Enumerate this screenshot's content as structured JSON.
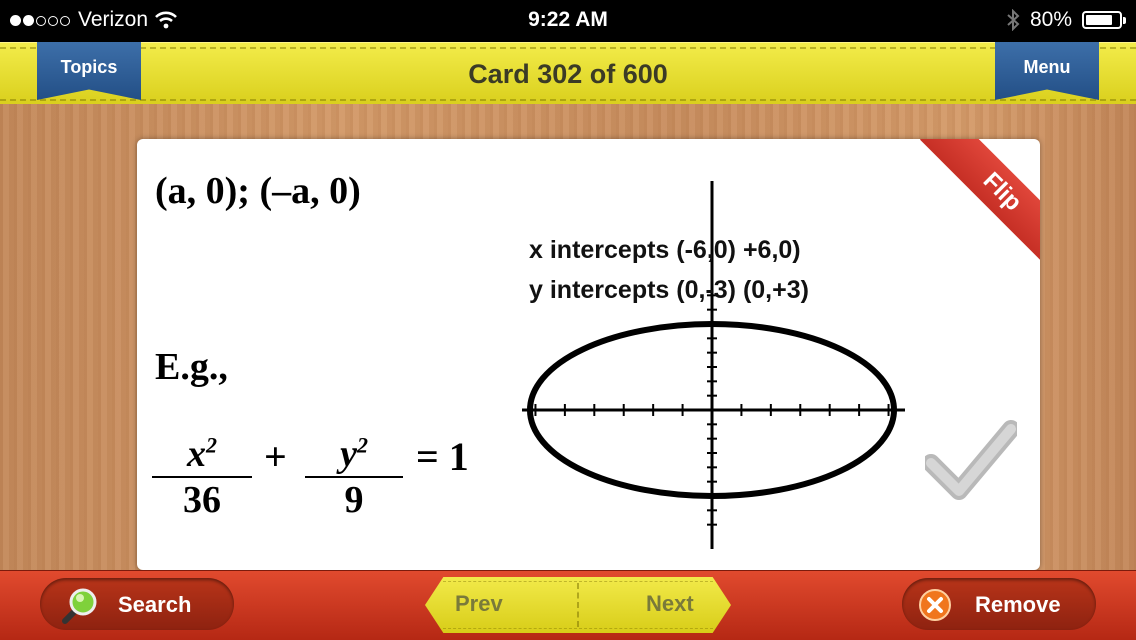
{
  "status_bar": {
    "signal_dots_filled": 2,
    "signal_dots_total": 5,
    "carrier": "Verizon",
    "time": "9:22 AM",
    "battery_percent": "80%",
    "battery_level": 0.8
  },
  "header": {
    "topics_label": "Topics",
    "title": "Card 302 of 600",
    "menu_label": "Menu"
  },
  "card": {
    "flip_label": "Flip",
    "intercepts_text": "(a,  0);  (–a,  0)",
    "example_label": "E.g.,",
    "equation": {
      "term1_num": "x",
      "term1_exp": "2",
      "term1_den": "36",
      "plus": "+",
      "term2_num": "y",
      "term2_exp": "2",
      "term2_den": "9",
      "equals": "= 1"
    },
    "graph": {
      "x_intercepts_label": "x intercepts (-6,0) +6,0)",
      "y_intercepts_label": "y intercepts (0,-3) (0,+3)",
      "semi_major": 6,
      "semi_minor": 3
    }
  },
  "footer": {
    "search_label": "Search",
    "prev_label": "Prev",
    "next_label": "Next",
    "remove_label": "Remove"
  },
  "colors": {
    "header_yellow": "#e6dd2b",
    "ribbon_blue": "#2f5f98",
    "footer_red": "#c93620",
    "flip_red": "#d63b2f"
  }
}
